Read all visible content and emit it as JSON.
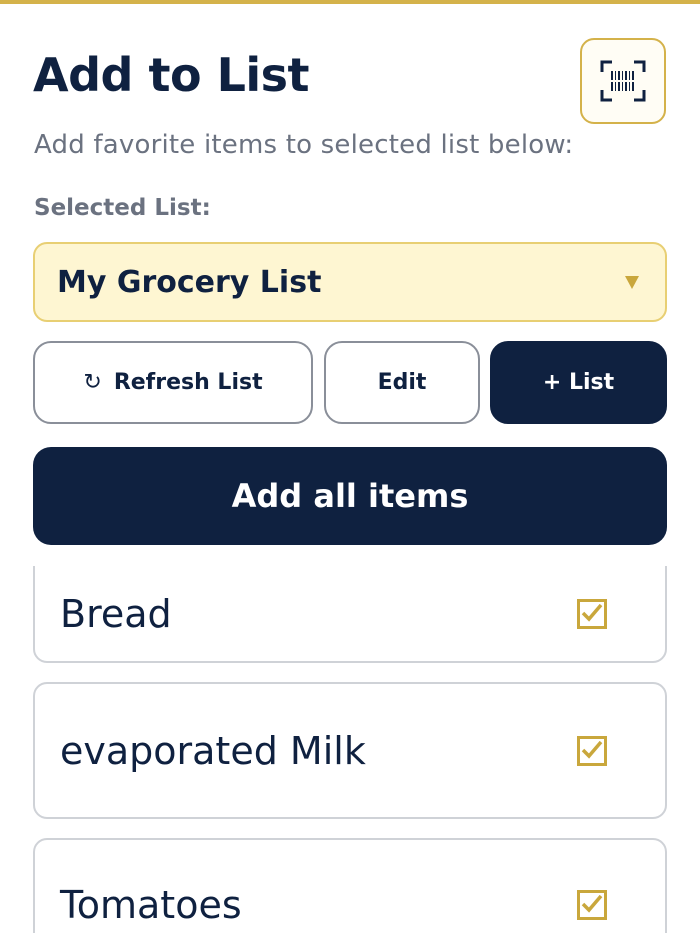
{
  "header": {
    "title": "Add to List",
    "subtitle": "Add favorite items to selected list below:",
    "scan_icon": "barcode-scan-icon"
  },
  "list_selector": {
    "label": "Selected List:",
    "value": "My Grocery List",
    "icon": "chevron-down-icon"
  },
  "actions": {
    "refresh_label": "Refresh List",
    "refresh_icon": "refresh-icon",
    "edit_label": "Edit",
    "add_list_label": "+ List",
    "add_all_label": "Add all items"
  },
  "items": [
    {
      "name": "Bread",
      "checked": true
    },
    {
      "name": "evaporated Milk",
      "checked": true
    },
    {
      "name": "Tomatoes",
      "checked": true
    }
  ],
  "colors": {
    "navy": "#0f2140",
    "gold": "#d4b24a",
    "select_bg": "#fef6d2",
    "muted_text": "#6b7280"
  }
}
